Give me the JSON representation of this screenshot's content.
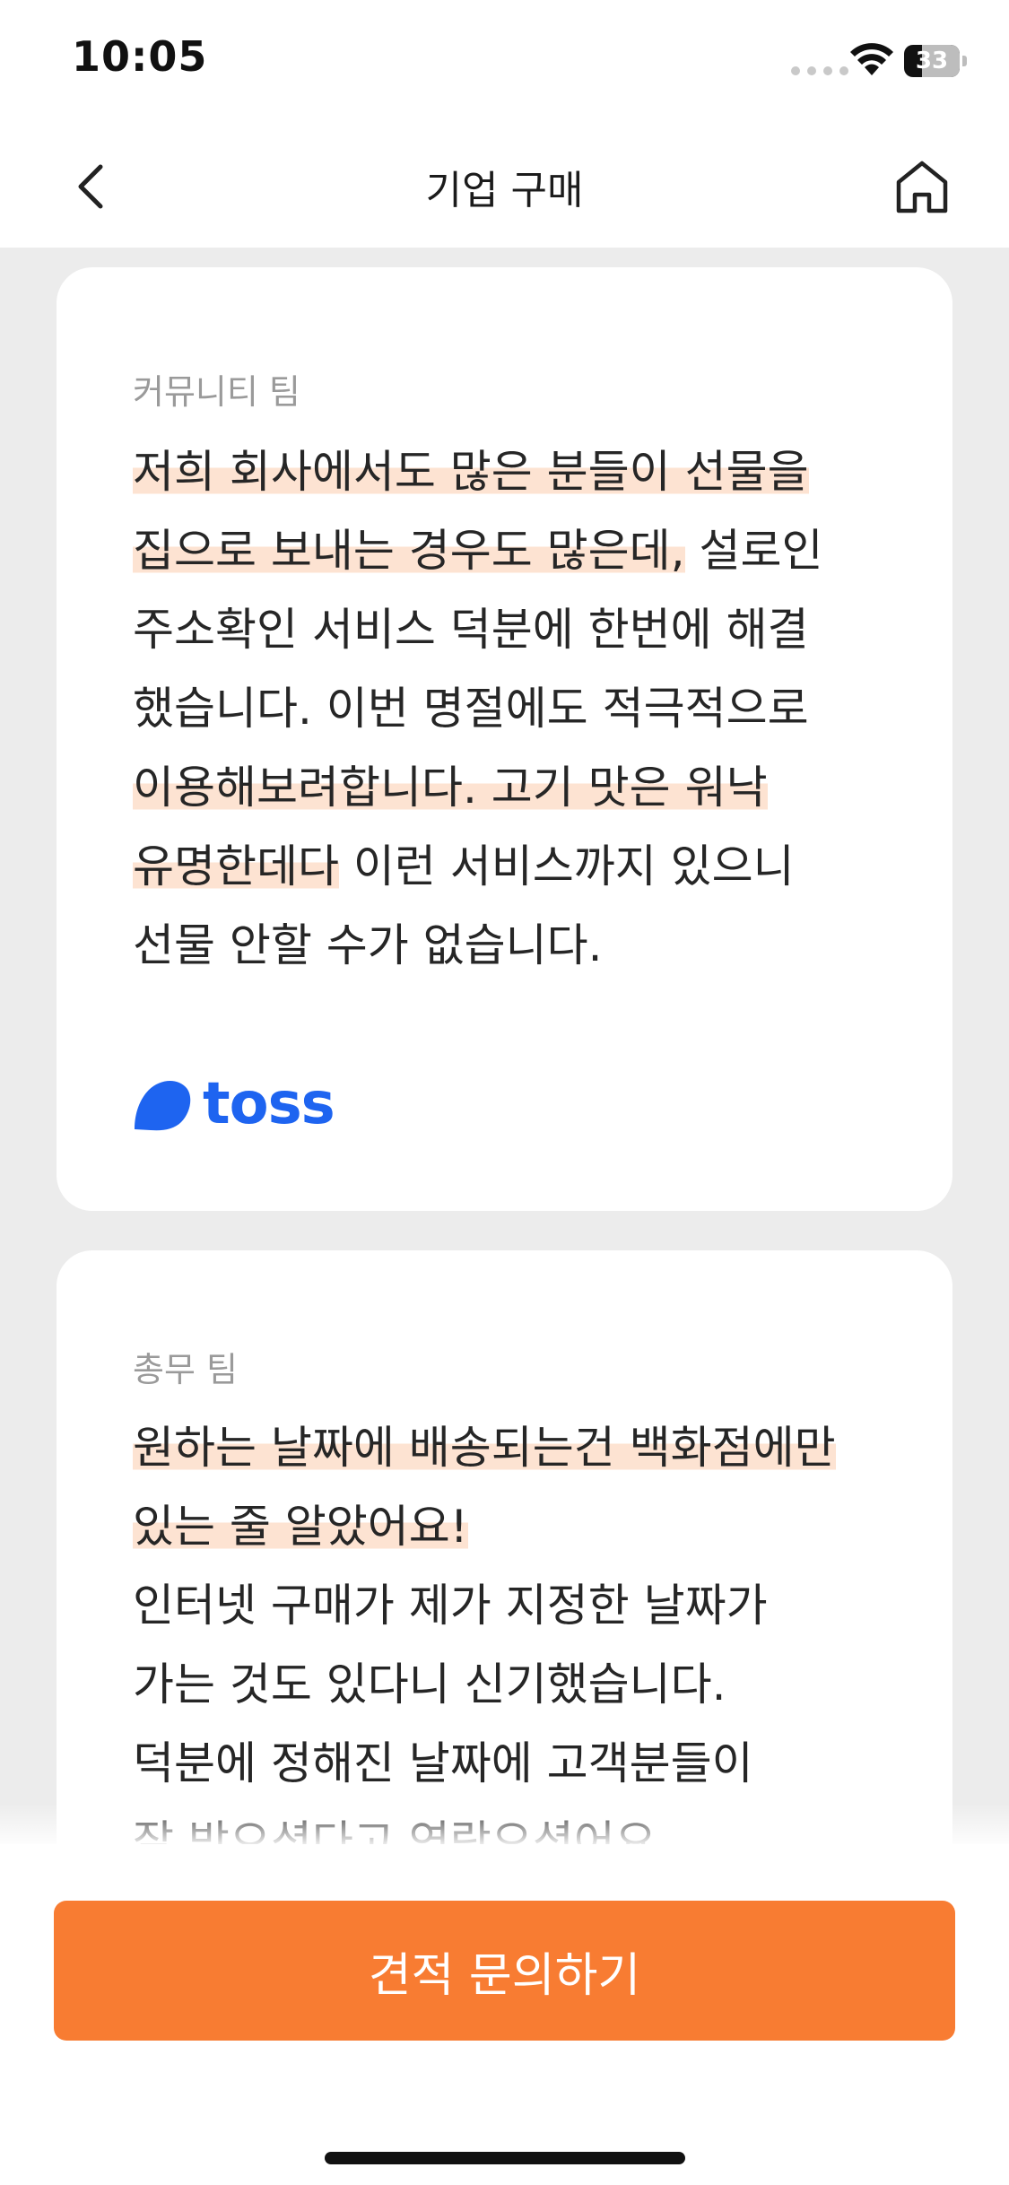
{
  "status_bar": {
    "time": "10:05",
    "battery": "33"
  },
  "nav": {
    "title": "기업 구매"
  },
  "testimonials": [
    {
      "team": "커뮤니티 팀",
      "quote": [
        {
          "text": "저희 회사에서도 많은 분들이 선물을",
          "highlight": true,
          "br": true
        },
        {
          "text": "집으로 보내는 경우도 많은데,",
          "highlight": true
        },
        {
          "text": " 설로인",
          "highlight": false,
          "br": true
        },
        {
          "text": "주소확인 서비스 덕분에 한번에 해결",
          "highlight": false,
          "br": true
        },
        {
          "text": "했습니다.  이번 명절에도 적극적으로",
          "highlight": false,
          "br": true
        },
        {
          "text": "이용해보려합니다. 고기 맛은 워낙",
          "highlight": true,
          "br": true
        },
        {
          "text": "유명한데다",
          "highlight": true
        },
        {
          "text": " 이런 서비스까지 있으니",
          "highlight": false,
          "br": true
        },
        {
          "text": "선물 안할 수가 없습니다.",
          "highlight": false
        }
      ],
      "company_logo": "toss"
    },
    {
      "team": "총무 팀",
      "quote": [
        {
          "text": "원하는 날짜에 배송되는건 백화점에만",
          "highlight": true,
          "br": true
        },
        {
          "text": "있는 줄 알았어요!",
          "highlight": true,
          "br": true
        },
        {
          "text": "인터넷 구매가 제가 지정한 날짜가",
          "highlight": false,
          "br": true
        },
        {
          "text": "가는 것도 있다니 신기했습니다.",
          "highlight": false,
          "br": true
        },
        {
          "text": "덕분에 정해진 날짜에 고객분들이",
          "highlight": false,
          "br": true
        },
        {
          "text": "잘 받으셨다고 연락오셨어요.",
          "highlight": false
        }
      ]
    }
  ],
  "cta": {
    "label": "견적 문의하기"
  },
  "icons": {
    "back": "chevron-left-icon",
    "home": "home-icon",
    "wifi": "wifi-icon",
    "battery": "battery-icon",
    "toss_mark": "toss-mark-icon"
  },
  "colors": {
    "accent": "#f87c32",
    "highlight": "#fde3d2",
    "toss_blue": "#1e64f0",
    "background": "#ececec"
  }
}
